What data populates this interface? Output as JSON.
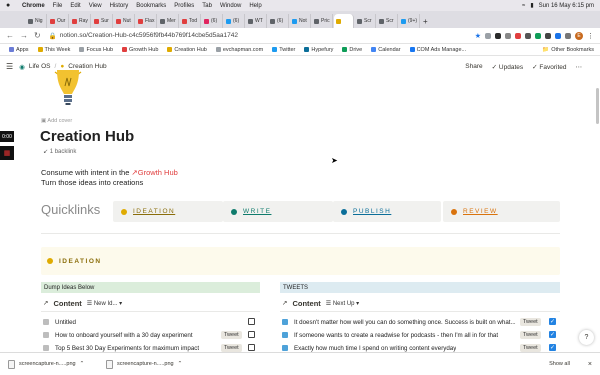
{
  "mac_menu": {
    "apple": "",
    "items": [
      "Chrome",
      "File",
      "Edit",
      "View",
      "History",
      "Bookmarks",
      "Profiles",
      "Tab",
      "Window",
      "Help"
    ],
    "clock": "Sun 16 May  6:15 pm"
  },
  "tabs": [
    {
      "label": "Nig",
      "color": "#5f6368"
    },
    {
      "label": "Our",
      "color": "#e03e3e"
    },
    {
      "label": "Ray",
      "color": "#e03e3e"
    },
    {
      "label": "Sur",
      "color": "#e03e3e"
    },
    {
      "label": "Nut",
      "color": "#e03e3e"
    },
    {
      "label": "Flax",
      "color": "#e03e3e"
    },
    {
      "label": "Mer",
      "color": "#5f6368"
    },
    {
      "label": "Tod",
      "color": "#e03e3e"
    },
    {
      "label": "(6)",
      "color": "#e0245e"
    },
    {
      "label": "(6)",
      "color": "#1d9bf0"
    },
    {
      "label": "WT",
      "color": "#5f6368"
    },
    {
      "label": "(6)",
      "color": "#5f6368"
    },
    {
      "label": "Not",
      "color": "#1d9bf0"
    },
    {
      "label": "Pric",
      "color": "#5f6368"
    },
    {
      "label": "",
      "color": "#dfab01",
      "active": true
    },
    {
      "label": "Scr",
      "color": "#5f6368"
    },
    {
      "label": "Scr",
      "color": "#5f6368"
    },
    {
      "label": "(9+)",
      "color": "#1d9bf0"
    }
  ],
  "address": {
    "url": "notion.so/Creation-Hub-c4c5956f9fb44b769f14cbe5d5aa1742"
  },
  "bookmarks": [
    {
      "label": "Apps",
      "color": "#6b7cd6"
    },
    {
      "label": "This Week",
      "color": "#dfab01"
    },
    {
      "label": "Focus Hub",
      "color": "#9aa0a6"
    },
    {
      "label": "Growth Hub",
      "color": "#e03e3e"
    },
    {
      "label": "Creation Hub",
      "color": "#dfab01"
    },
    {
      "label": "evchapman.com",
      "color": "#9aa0a6"
    },
    {
      "label": "Twitter",
      "color": "#1d9bf0"
    },
    {
      "label": "Hypefury",
      "color": "#0b6e99"
    },
    {
      "label": "Drive",
      "color": "#0f9d58"
    },
    {
      "label": "Calendar",
      "color": "#4285f4"
    },
    {
      "label": "COM Ads Manage...",
      "color": "#1877f2"
    }
  ],
  "bookmarks_other": "Other Bookmarks",
  "notion_top": {
    "crumb_root": "Life OS",
    "crumb_sep": "/",
    "crumb_page": "Creation Hub",
    "share": "Share",
    "updates": "Updates",
    "favorited": "Favorited"
  },
  "side_tag": "0:00",
  "page": {
    "add_cover": "Add cover",
    "title": "Creation Hub",
    "backlink": "1 backlink",
    "intro_prefix": "Consume with intent in the",
    "intro_link": "Growth Hub",
    "intro_line2": "Turn those ideas into creations",
    "quicklinks": "Quicklinks"
  },
  "quick_cards": [
    {
      "label": "IDEATION",
      "color": "#dfab01",
      "text_color": "#8a6d0a",
      "bg": "#fbf3db"
    },
    {
      "label": "WRITE",
      "color": "#0f7b6c",
      "text_color": "#0f7b6c",
      "bg": "#eef3ed"
    },
    {
      "label": "PUBLISH",
      "color": "#0b6e99",
      "text_color": "#0b6e99",
      "bg": "#e7f3f8"
    },
    {
      "label": "REVIEW",
      "color": "#d9730d",
      "text_color": "#d9730d",
      "bg": "#faebdd"
    }
  ],
  "ideation_banner": "IDEATION",
  "left_column": {
    "header": "Dump Ideas Below",
    "header_bg": "#dbeddb",
    "view_title": "Content",
    "view_dropdown": "New Id...",
    "rows": [
      {
        "title": "Untitled",
        "tag": "",
        "checked": false
      },
      {
        "title": "How to onboard yourself with a 30 day experiment",
        "tag": "Tweet",
        "checked": false
      },
      {
        "title": "Top 5 Best 30 Day Experiments for maximum impact",
        "tag": "Tweet",
        "checked": false
      }
    ]
  },
  "right_column": {
    "header": "TWEETS",
    "header_bg": "#ddebf1",
    "view_title": "Content",
    "view_dropdown": "Next Up",
    "rows": [
      {
        "title": "It doesn't matter how well you can do something once. Success is built on what...",
        "tag": "Tweet",
        "checked": true
      },
      {
        "title": "If someone wants to create a readwise for podcasts - then I'm all in for that",
        "tag": "Tweet",
        "checked": true
      },
      {
        "title": "Exactly how much time I spend on writing content everyday",
        "tag": "Tweet",
        "checked": true
      }
    ]
  },
  "help": "?",
  "downloads": {
    "files": [
      "screencapture-n.....png",
      "screencapture-n.....png"
    ],
    "show_all": "Show all",
    "close": "×"
  }
}
